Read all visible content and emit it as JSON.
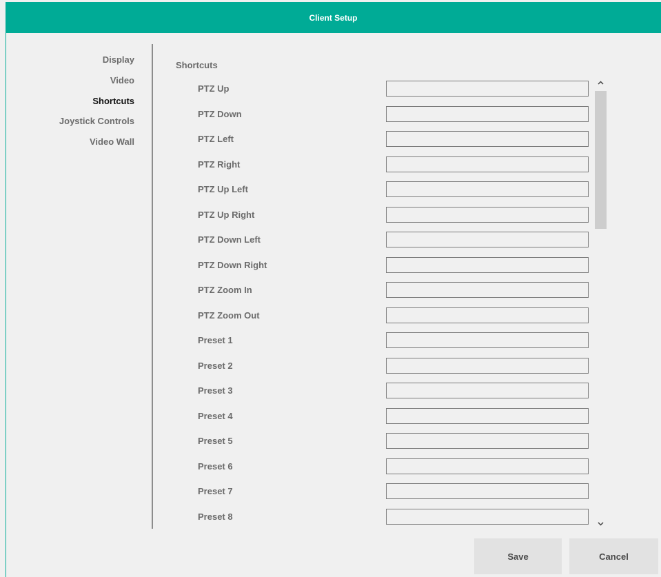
{
  "window": {
    "title": "Client Setup"
  },
  "sidebar": {
    "items": [
      {
        "label": "Display",
        "active": false
      },
      {
        "label": "Video",
        "active": false
      },
      {
        "label": "Shortcuts",
        "active": true
      },
      {
        "label": "Joystick Controls",
        "active": false
      },
      {
        "label": "Video Wall",
        "active": false
      }
    ]
  },
  "main": {
    "section_title": "Shortcuts",
    "shortcuts": [
      {
        "label": "PTZ Up",
        "value": ""
      },
      {
        "label": "PTZ Down",
        "value": ""
      },
      {
        "label": "PTZ Left",
        "value": ""
      },
      {
        "label": "PTZ Right",
        "value": ""
      },
      {
        "label": "PTZ Up Left",
        "value": ""
      },
      {
        "label": "PTZ Up Right",
        "value": ""
      },
      {
        "label": "PTZ Down Left",
        "value": ""
      },
      {
        "label": "PTZ Down Right",
        "value": ""
      },
      {
        "label": "PTZ Zoom In",
        "value": ""
      },
      {
        "label": "PTZ Zoom Out",
        "value": ""
      },
      {
        "label": "Preset 1",
        "value": ""
      },
      {
        "label": "Preset 2",
        "value": ""
      },
      {
        "label": "Preset 3",
        "value": ""
      },
      {
        "label": "Preset 4",
        "value": ""
      },
      {
        "label": "Preset 5",
        "value": ""
      },
      {
        "label": "Preset 6",
        "value": ""
      },
      {
        "label": "Preset 7",
        "value": ""
      },
      {
        "label": "Preset 8",
        "value": ""
      }
    ],
    "scroll_position": 0.0
  },
  "footer": {
    "save_label": "Save",
    "cancel_label": "Cancel"
  },
  "icons": {
    "scroll_up": "chevron-up-icon",
    "scroll_down": "chevron-down-icon"
  },
  "colors": {
    "accent": "#00ab96"
  }
}
